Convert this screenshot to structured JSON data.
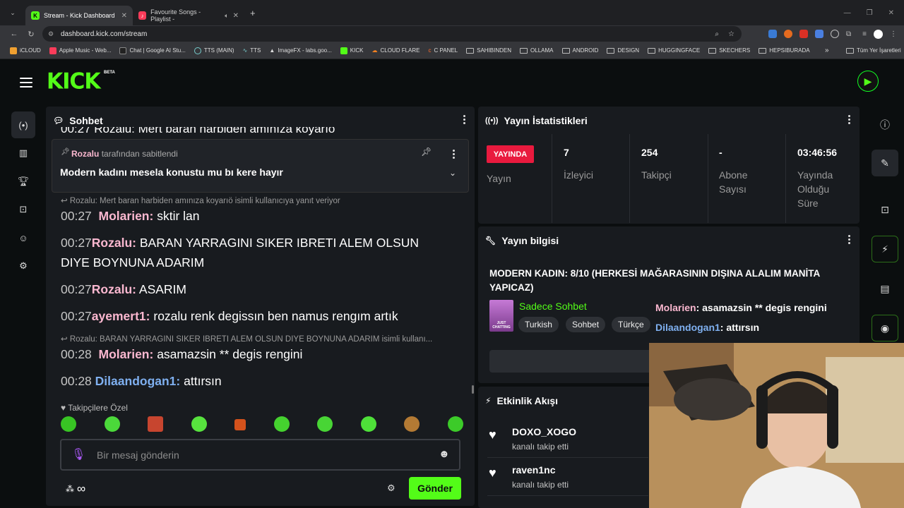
{
  "browser": {
    "tabs": [
      {
        "label": "Stream - Kick Dashboard",
        "active": true
      },
      {
        "label": "Favourite Songs - Playlist - ",
        "active": false
      }
    ],
    "url": "dashboard.kick.com/stream",
    "bookmarks": [
      "iCLOUD",
      "Apple Music - Web...",
      "Chat | Google AI Stu...",
      "TTS (MAIN)",
      "TTS",
      "ImageFX - labs.goo...",
      "KICK",
      "CLOUD FLARE",
      "C PANEL",
      "SAHIBINDEN",
      "OLLAMA",
      "ANDROID",
      "DESIGN",
      "HUGGINGFACE",
      "SKECHERS",
      "HEPSIBURADA"
    ],
    "bookmarks_more": "»",
    "all_bookmarks": "Tüm Yer İşaretleri"
  },
  "header": {
    "logo": "KICK",
    "beta": "BETA"
  },
  "chat": {
    "title": "Sohbet",
    "cut_top": "00:27 Rozalu: Mert baran harbiden amınıza koyarıo",
    "pinned": {
      "user": "Rozalu",
      "suffix": "tarafından sabitlendi",
      "text": "Modern kadını mesela konustu mu bı kere hayır"
    },
    "reply1": "Rozalu: Mert baran harbiden amınıza koyarıö isimli kullanıcıya yanıt veriyor",
    "messages": [
      {
        "time": "00:27",
        "user": "Molarien:",
        "text": "sktir lan"
      },
      {
        "time": "00:27",
        "user": "Rozalu:",
        "text": "BARAN YARRAGINI SIKER IBRETI ALEM OLSUN",
        "text2": "DIYE BOYNUNA ADARIM"
      },
      {
        "time": "00:27",
        "user": "Rozalu:",
        "text": "ASARIM"
      },
      {
        "time": "00:27",
        "user": "ayemert1:",
        "text": "rozalu renk degissın ben namus rengım artık"
      },
      {
        "time": "00:28",
        "user": "Molarien:",
        "text": "asamazsin ** degis rengini"
      },
      {
        "time": "00:28",
        "user": "Dilaandogan1:",
        "text": "attırsın"
      }
    ],
    "reply2": "Rozalu: BARAN YARRAGINI SIKER IBRETI ALEM OLSUN DIYE BOYNUNA ADARIM isimli kullanı...",
    "followers_only": "Takipçilere Özel",
    "input_placeholder": "Bir mesaj gönderin",
    "send_label": "Gönder",
    "infinity": "∞"
  },
  "stats": {
    "title": "Yayın İstatistikleri",
    "live_badge": "YAYINDA",
    "live_label": "Yayın",
    "viewers": {
      "value": "7",
      "label": "İzleyici"
    },
    "followers": {
      "value": "254",
      "label": "Takipçi"
    },
    "subs": {
      "value": "-",
      "label1": "Abone",
      "label2": "Sayısı"
    },
    "uptime": {
      "value": "03:46:56",
      "label1": "Yayında",
      "label2": "Olduğu",
      "label3": "Süre"
    }
  },
  "info": {
    "title": "Yayın bilgisi",
    "stream_title1": "MODERN KADIN: 8/10 (HERKESİ MAĞARASININ DIŞINA ALALIM MANİTA",
    "stream_title2": "YAPICAZ)",
    "category": "Sadece Sohbet",
    "thumb_text": "JUST CHATTING",
    "tags": [
      "Turkish",
      "Sohbet",
      "Türkçe"
    ],
    "overlay": [
      {
        "user": "Molarien",
        "text": ": asamazsin ** degis rengini"
      },
      {
        "user": "Dilaandogan1",
        "text": ": attırsın"
      }
    ]
  },
  "feed": {
    "title": "Etkinlik Akışı",
    "items": [
      {
        "user": "DOXO_XOGO",
        "action": "kanalı takip etti"
      },
      {
        "user": "raven1nc",
        "action": "kanalı takip etti"
      }
    ]
  },
  "colors": {
    "accent": "#53fc18",
    "live": "#e91a3e",
    "user_pink": "#fbb8d0",
    "user_blue": "#7fb0f0"
  }
}
